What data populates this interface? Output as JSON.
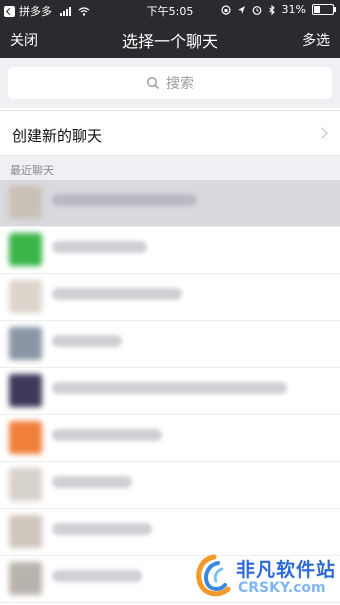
{
  "status_bar": {
    "back_app": "拼多多",
    "time": "下午5:05",
    "battery": "31%",
    "battery_level": 0.31
  },
  "nav": {
    "close_label": "关闭",
    "title": "选择一个聊天",
    "multi_select_label": "多选"
  },
  "search": {
    "placeholder": "搜索"
  },
  "new_chat": {
    "label": "创建新的聊天"
  },
  "recent": {
    "header": "最近聊天",
    "chats": [
      {
        "avatar_color": "#c9c0b6",
        "blurred": true
      },
      {
        "avatar_color": "#3bb54a",
        "blurred": true
      },
      {
        "avatar_color": "#ddd5cc",
        "blurred": true
      },
      {
        "avatar_color": "#8a96a6",
        "blurred": true
      },
      {
        "avatar_color": "#3d3a5a",
        "blurred": true
      },
      {
        "avatar_color": "#f07f3b",
        "blurred": true
      },
      {
        "avatar_color": "#d8d2cc",
        "blurred": true
      },
      {
        "avatar_color": "#cfc6bd",
        "blurred": true
      },
      {
        "avatar_color": "#b9b3ad",
        "blurred": true
      }
    ]
  },
  "watermark": {
    "cn": "非凡软件站",
    "en": "CRSKY.com"
  }
}
